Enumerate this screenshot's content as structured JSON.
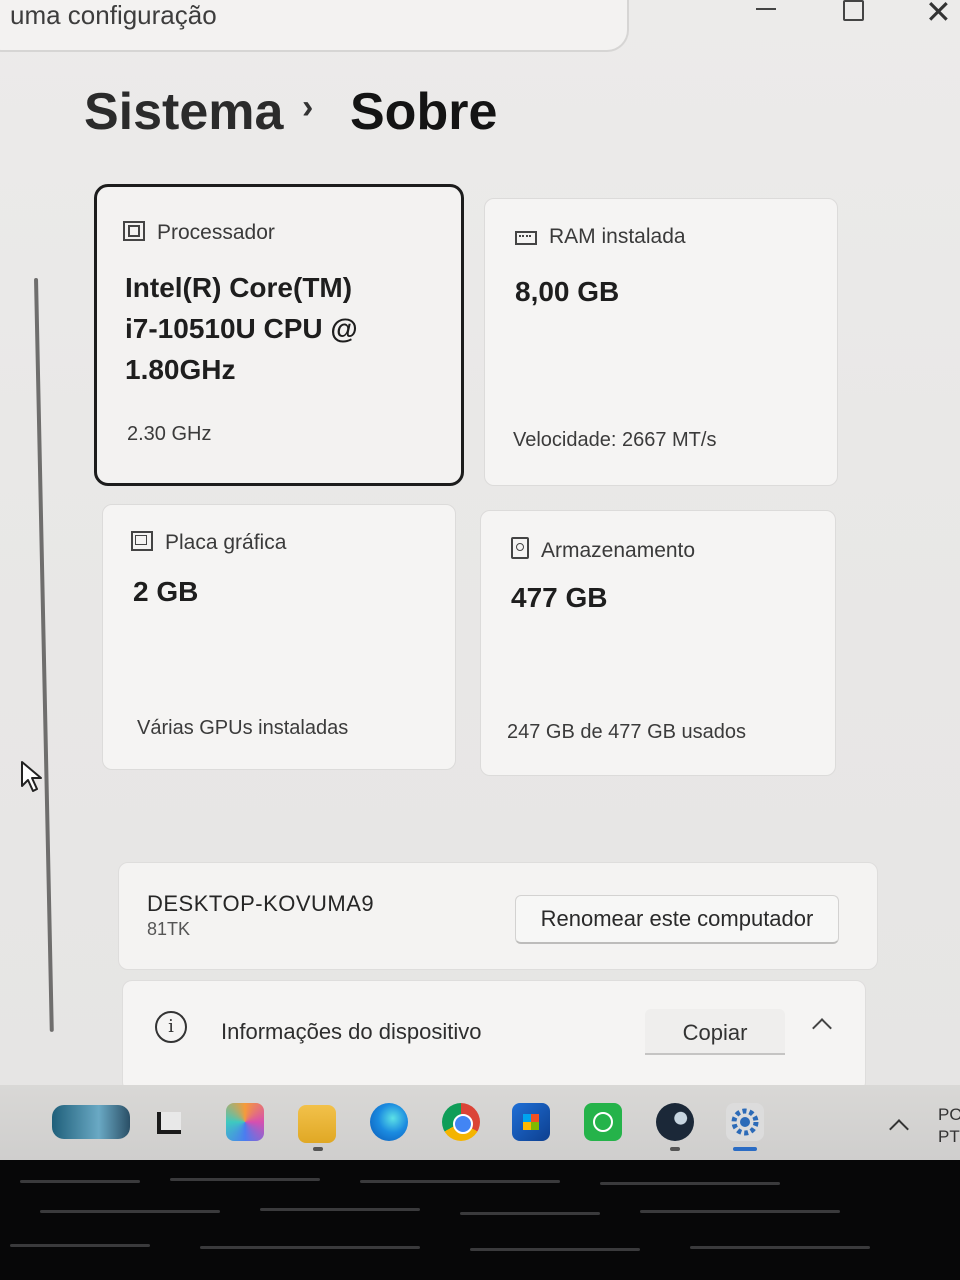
{
  "search": {
    "text": "uma configuração"
  },
  "breadcrumb": {
    "parent": "Sistema",
    "separator": "›",
    "current": "Sobre"
  },
  "cards": {
    "processor": {
      "title": "Processador",
      "value_lines": [
        "Intel(R) Core(TM)",
        "i7-10510U CPU @",
        "1.80GHz"
      ],
      "sub": "2.30 GHz",
      "icon": "cpu-icon"
    },
    "ram": {
      "title": "RAM instalada",
      "value": "8,00 GB",
      "sub": "Velocidade: 2667 MT/s",
      "icon": "memory-icon"
    },
    "gpu": {
      "title": "Placa gráfica",
      "value": "2 GB",
      "sub": "Várias GPUs instaladas",
      "icon": "gpu-icon"
    },
    "storage": {
      "title": "Armazenamento",
      "value": "477 GB",
      "sub": "247 GB de 477 GB usados",
      "icon": "storage-icon"
    }
  },
  "device": {
    "name": "DESKTOP-KOVUMA9",
    "model": "81TK",
    "rename_label": "Renomear este computador"
  },
  "device_info": {
    "label": "Informações do dispositivo",
    "copy_label": "Copiar",
    "icon": "info-icon"
  },
  "taskbar": {
    "apps": [
      "widgets",
      "task-view",
      "copilot",
      "file-explorer",
      "edge",
      "chrome",
      "microsoft-store",
      "whatsapp",
      "steam",
      "settings"
    ],
    "tray_text": [
      "PO",
      "PT"
    ]
  },
  "colors": {
    "accent": "#2b6cc4",
    "selected_border": "#1c1c1c"
  }
}
